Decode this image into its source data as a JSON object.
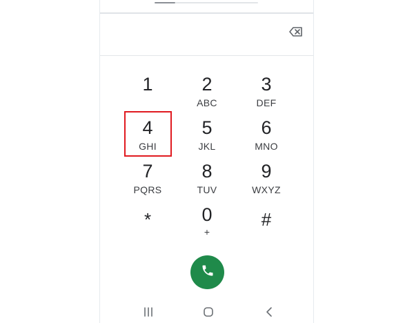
{
  "dialer": {
    "keys": [
      {
        "digit": "1",
        "letters": ""
      },
      {
        "digit": "2",
        "letters": "ABC"
      },
      {
        "digit": "3",
        "letters": "DEF"
      },
      {
        "digit": "4",
        "letters": "GHI"
      },
      {
        "digit": "5",
        "letters": "JKL"
      },
      {
        "digit": "6",
        "letters": "MNO"
      },
      {
        "digit": "7",
        "letters": "PQRS"
      },
      {
        "digit": "8",
        "letters": "TUV"
      },
      {
        "digit": "9",
        "letters": "WXYZ"
      },
      {
        "digit": "*",
        "letters": ""
      },
      {
        "digit": "0",
        "letters": "+"
      },
      {
        "digit": "#",
        "letters": ""
      }
    ],
    "highlighted_key": "4"
  },
  "icons": {
    "backspace": "backspace-icon",
    "call": "phone-icon",
    "recents": "recent-apps-icon",
    "home": "home-icon",
    "back": "back-icon"
  },
  "colors": {
    "call_button": "#1f8a4a",
    "highlight": "#e0191f"
  }
}
